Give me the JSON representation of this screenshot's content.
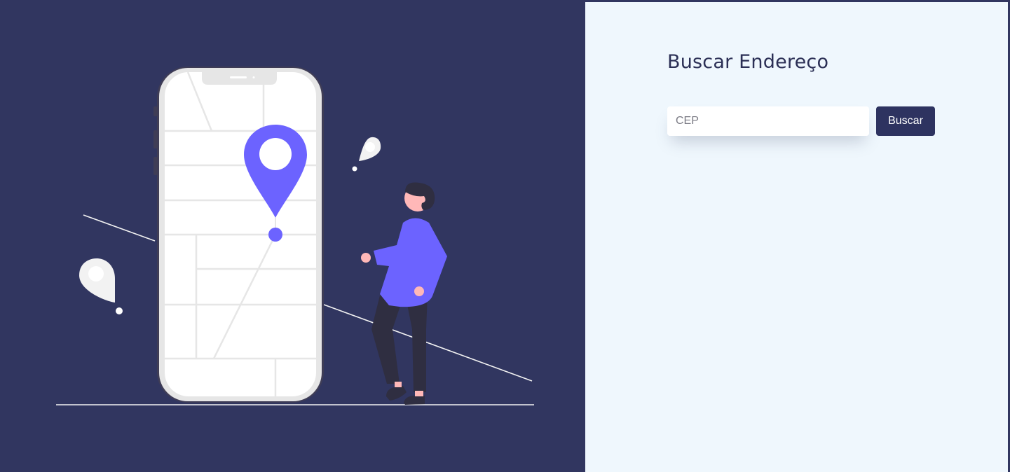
{
  "search": {
    "title": "Buscar Endereço",
    "cep_placeholder": "CEP",
    "cep_value": "",
    "button_label": "Buscar"
  },
  "colors": {
    "background_dark": "#313660",
    "panel_light": "#eff7fd",
    "accent_purple": "#6c63ff",
    "button": "#2e3360"
  },
  "illustration": {
    "icons": [
      "smartphone-map",
      "location-pin-icon",
      "person-walking",
      "map-marker-bubble-icon"
    ]
  }
}
